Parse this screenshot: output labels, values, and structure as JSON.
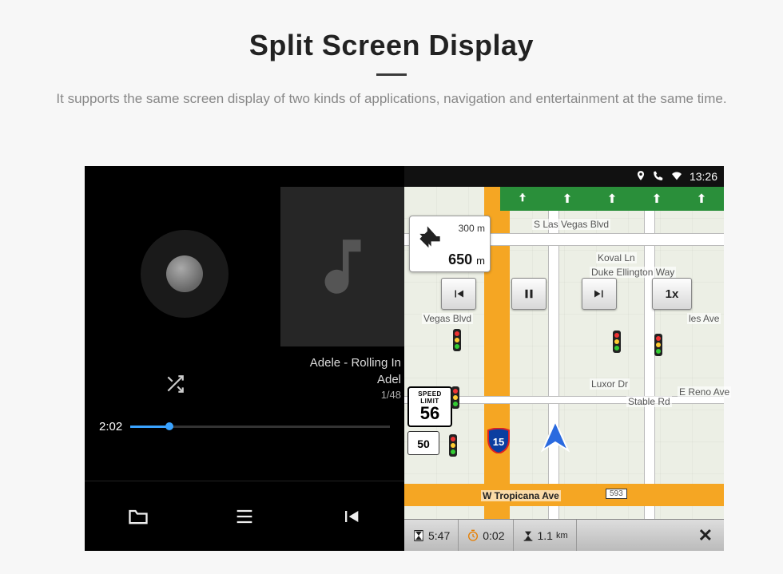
{
  "header": {
    "title": "Split Screen Display",
    "subtitle": "It supports the same screen display of two kinds of applications, navigation and entertainment at the same time."
  },
  "statusbar": {
    "time": "13:26"
  },
  "music": {
    "track_title": "Adele - Rolling In",
    "track_artist": "Adel",
    "track_index": "1/48",
    "elapsed": "2:02"
  },
  "nav": {
    "turn_small_dist": "300",
    "turn_small_unit": "m",
    "turn_big_dist": "650",
    "turn_big_unit": "m",
    "speed_label": "SPEED LIMIT",
    "speed_value": "56",
    "route_50": "50",
    "interstate_15": "15",
    "speed_multiplier": "1x",
    "arrival_time": "5:47",
    "trip_time": "0:02",
    "trip_dist": "1.1",
    "trip_dist_unit": "km",
    "current_road_marker": "593",
    "streets": {
      "s_las_vegas": "S Las Vegas Blvd",
      "koval": "Koval Ln",
      "duke": "Duke Ellington Way",
      "luxor": "Luxor Dr",
      "stable": "Stable Rd",
      "reno": "E Reno Ave",
      "tropicana": "W Tropicana Ave",
      "vegas_blvd_side": "Vegas Blvd",
      "les_ave": "les Ave"
    }
  }
}
